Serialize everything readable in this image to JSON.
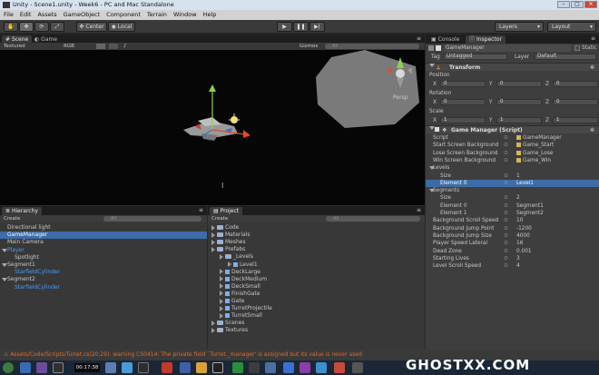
{
  "window": {
    "title": "Unity - Scene1.unity - Week6 - PC and Mac Standalone"
  },
  "menu": [
    "File",
    "Edit",
    "Assets",
    "GameObject",
    "Component",
    "Terrain",
    "Window",
    "Help"
  ],
  "toolbar": {
    "pivot_label": "Center",
    "space_label": "Local",
    "layers_label": "Layers",
    "layout_label": "Layout"
  },
  "scene": {
    "tabs": [
      "Scene",
      "Game"
    ],
    "render_mode": "Textured",
    "color_mode": "RGB",
    "gizmos_label": "Gizmos",
    "search_placeholder": "All",
    "persp_label": "Persp"
  },
  "hierarchy": {
    "tab": "Hierarchy",
    "create_label": "Create",
    "search_placeholder": "All",
    "items": [
      {
        "label": "Directional light",
        "indent": 0,
        "style": "normal"
      },
      {
        "label": "GameManager",
        "indent": 0,
        "style": "selected"
      },
      {
        "label": "Main Camera",
        "indent": 0,
        "style": "normal"
      },
      {
        "label": "Player",
        "indent": 0,
        "style": "prefab",
        "expanded": true
      },
      {
        "label": "Spotlight",
        "indent": 1,
        "style": "normal"
      },
      {
        "label": "Segment1",
        "indent": 0,
        "style": "normal",
        "expanded": true
      },
      {
        "label": "StarfieldCylinder",
        "indent": 1,
        "style": "prefab"
      },
      {
        "label": "Segment2",
        "indent": 0,
        "style": "normal",
        "expanded": true
      },
      {
        "label": "StarfieldCylinder",
        "indent": 1,
        "style": "prefab"
      }
    ]
  },
  "project": {
    "tab": "Project",
    "create_label": "Create",
    "search_placeholder": "All",
    "items": [
      {
        "label": "Code",
        "indent": 0,
        "kind": "folder"
      },
      {
        "label": "Materials",
        "indent": 0,
        "kind": "folder"
      },
      {
        "label": "Meshes",
        "indent": 0,
        "kind": "folder"
      },
      {
        "label": "Prefabs",
        "indent": 0,
        "kind": "folder"
      },
      {
        "label": "_Levels",
        "indent": 1,
        "kind": "folder"
      },
      {
        "label": "Level1",
        "indent": 2,
        "kind": "prefab"
      },
      {
        "label": "DeckLarge",
        "indent": 1,
        "kind": "prefab"
      },
      {
        "label": "DeckMedium",
        "indent": 1,
        "kind": "prefab"
      },
      {
        "label": "DeckSmall",
        "indent": 1,
        "kind": "prefab"
      },
      {
        "label": "FinishGate",
        "indent": 1,
        "kind": "prefab"
      },
      {
        "label": "Gate",
        "indent": 1,
        "kind": "prefab"
      },
      {
        "label": "TurretProjectile",
        "indent": 1,
        "kind": "prefab"
      },
      {
        "label": "TurretSmall",
        "indent": 1,
        "kind": "prefab"
      },
      {
        "label": "Scenes",
        "indent": 0,
        "kind": "folder"
      },
      {
        "label": "Textures",
        "indent": 0,
        "kind": "folder"
      }
    ]
  },
  "inspector": {
    "tabs": [
      "Console",
      "Inspector"
    ],
    "object_name": "GameManager",
    "static_label": "Static",
    "tag_label": "Tag",
    "tag_value": "Untagged",
    "layer_label": "Layer",
    "layer_value": "Default",
    "transform": {
      "title": "Transform",
      "position_label": "Position",
      "rotation_label": "Rotation",
      "scale_label": "Scale",
      "axes": [
        "X",
        "Y",
        "Z"
      ],
      "position": [
        "0",
        "0",
        "0"
      ],
      "rotation": [
        "0",
        "0",
        "0"
      ],
      "scale": [
        "1",
        "1",
        "1"
      ]
    },
    "script": {
      "title": "Game Manager (Script)",
      "fields": [
        {
          "label": "Script",
          "value": "GameManager",
          "indent": 0,
          "icon": true
        },
        {
          "label": "Start Screen Background",
          "value": "Game_Start",
          "indent": 0,
          "icon": true
        },
        {
          "label": "Lose Screen Background",
          "value": "Game_Lose",
          "indent": 0,
          "icon": true
        },
        {
          "label": "Win Screen Background",
          "value": "Game_Win",
          "indent": 0,
          "icon": true
        },
        {
          "label": "Levels",
          "value": "",
          "indent": 0,
          "foldout": true
        },
        {
          "label": "Size",
          "value": "1",
          "indent": 1
        },
        {
          "label": "Element 0",
          "value": "Level1",
          "indent": 1,
          "selected": true
        },
        {
          "label": "Segments",
          "value": "",
          "indent": 0,
          "foldout": true
        },
        {
          "label": "Size",
          "value": "2",
          "indent": 1
        },
        {
          "label": "Element 0",
          "value": "Segment1",
          "indent": 1
        },
        {
          "label": "Element 1",
          "value": "Segment2",
          "indent": 1
        },
        {
          "label": "Background Scroll Speed",
          "value": "10",
          "indent": 0
        },
        {
          "label": "Background Jump Point",
          "value": "-1200",
          "indent": 0
        },
        {
          "label": "Background Jump Size",
          "value": "4000",
          "indent": 0
        },
        {
          "label": "Player Speed Lateral",
          "value": "16",
          "indent": 0
        },
        {
          "label": "Dead Zone",
          "value": "0.001",
          "indent": 0
        },
        {
          "label": "Starting Lives",
          "value": "3",
          "indent": 0
        },
        {
          "label": "Level Scroll Speed",
          "value": "4",
          "indent": 0
        }
      ]
    }
  },
  "status": {
    "message": "Assets/Code/Scripts/Turret.cs(20,29): warning CS0414: The private field `Turret._manager' is assigned but its value is never used"
  },
  "taskbar": {
    "clock": "00:17:38"
  },
  "watermark": "GHOSTXX.COM",
  "colors": {
    "selection": "#3d6ca7",
    "prefab_text": "#4d9bf0",
    "warning_text": "#e06b2a"
  }
}
